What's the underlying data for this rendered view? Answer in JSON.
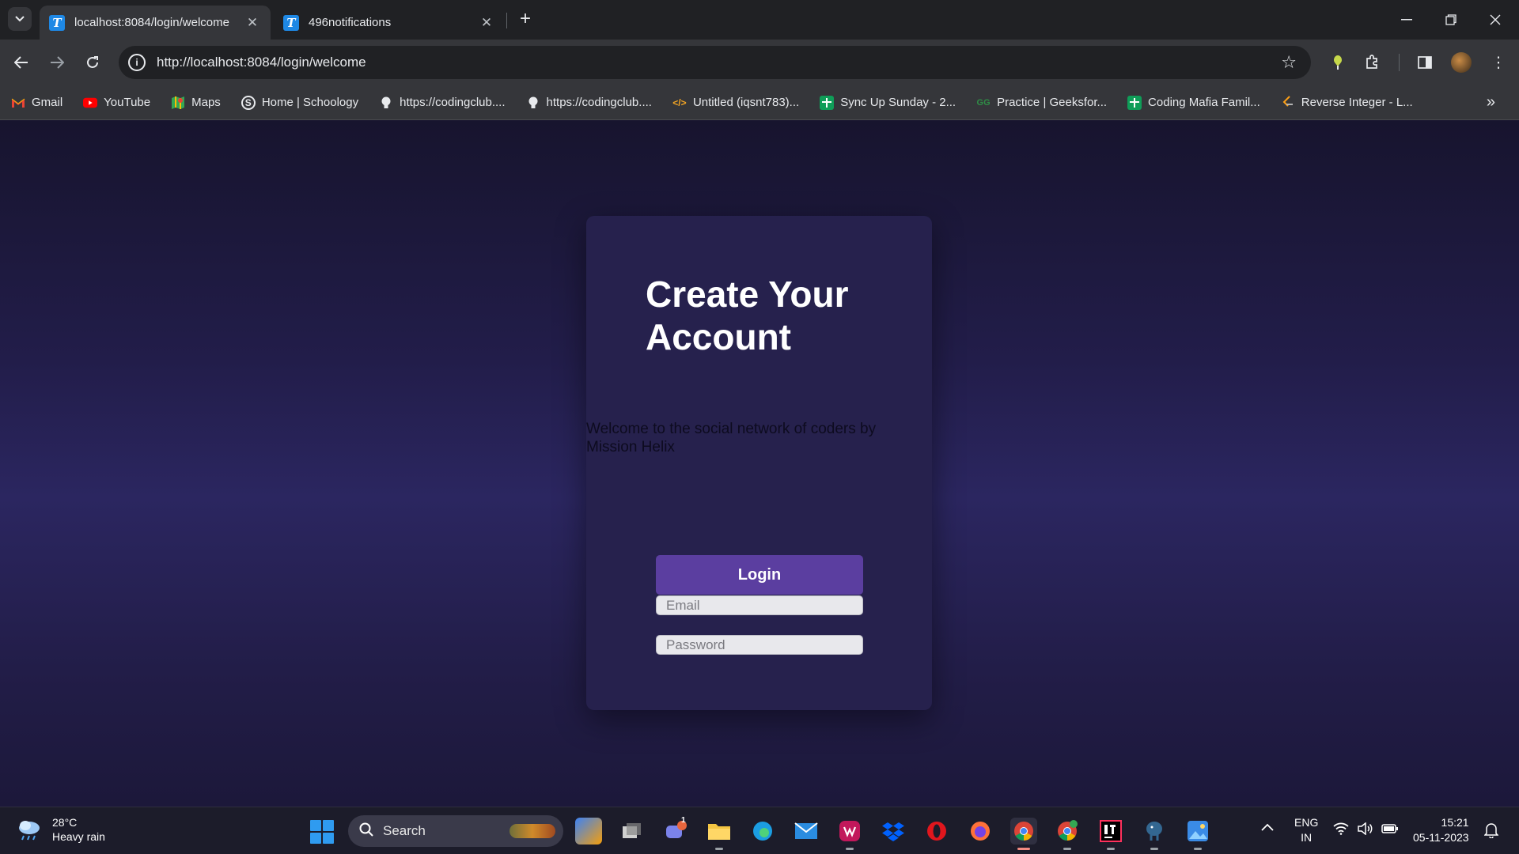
{
  "browser": {
    "tabs": [
      {
        "title": "localhost:8084/login/welcome",
        "favicon": "T",
        "active": true
      },
      {
        "title": "496notifications",
        "favicon": "T",
        "active": false
      }
    ],
    "url": "http://localhost:8084/login/welcome",
    "bookmarks": [
      {
        "label": "Gmail",
        "icon": "gmail-icon"
      },
      {
        "label": "YouTube",
        "icon": "youtube-icon"
      },
      {
        "label": "Maps",
        "icon": "maps-icon"
      },
      {
        "label": "Home | Schoology",
        "icon": "schoology-icon"
      },
      {
        "label": "https://codingclub....",
        "icon": "bulb-icon"
      },
      {
        "label": "https://codingclub....",
        "icon": "bulb-icon"
      },
      {
        "label": "Untitled (iqsnt783)...",
        "icon": "code-icon"
      },
      {
        "label": "Sync Up Sunday - 2...",
        "icon": "sheets-icon"
      },
      {
        "label": "Practice | Geeksfor...",
        "icon": "gfg-icon"
      },
      {
        "label": "Coding Mafia Famil...",
        "icon": "sheets-icon"
      },
      {
        "label": "Reverse Integer - L...",
        "icon": "leetcode-icon"
      }
    ]
  },
  "page": {
    "heading": "Create Your Account",
    "welcome_text": "Welcome to the social network of coders by Mission Helix",
    "email_placeholder": "Email",
    "password_placeholder": "Password",
    "login_label": "Login",
    "colors": {
      "card": "#26214d",
      "button": "#5b3ea0",
      "background": "#2b2660"
    }
  },
  "taskbar": {
    "weather_temp": "28°C",
    "weather_desc": "Heavy rain",
    "search_label": "Search",
    "teams_badge": "1",
    "language": "ENG",
    "region": "IN",
    "time": "15:21",
    "date": "05-11-2023"
  }
}
